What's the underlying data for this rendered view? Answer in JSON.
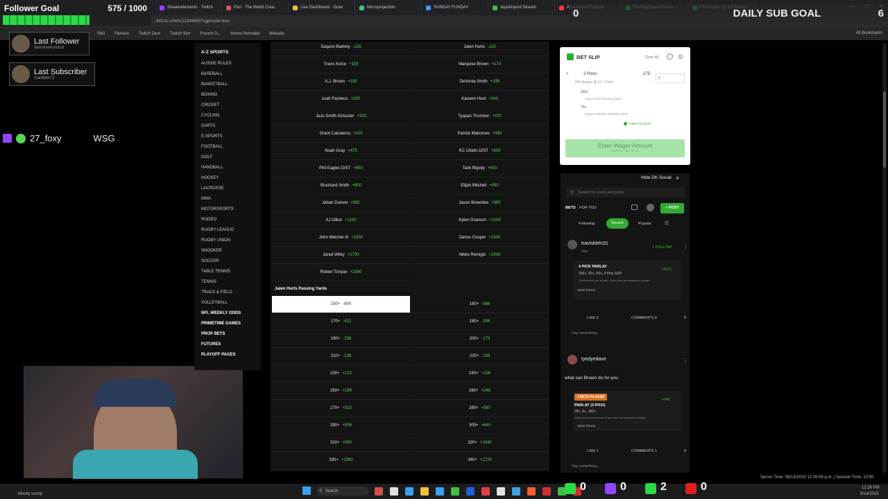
{
  "browser": {
    "tabs": [
      {
        "label": "Streamelements · Twitch",
        "color": "#9146ff"
      },
      {
        "label": "Purl · The Web3 Crea...",
        "color": "#e05050"
      },
      {
        "label": "Live Dashboard · Duse",
        "color": "#f0c040"
      },
      {
        "label": "Microprojection",
        "color": "#40c080"
      },
      {
        "label": "SUNDAY FUNDAY",
        "color": "#40a0f0"
      },
      {
        "label": "sbpulinyurd Stream",
        "color": "#40c040"
      },
      {
        "label": "Ameriquest Football",
        "color": "#e04040"
      },
      {
        "label": "FlutMagShow Stream",
        "color": "#40c040"
      },
      {
        "label": "PHI Eagles @ KC Chiefs",
        "color": "#40c040"
      }
    ],
    "url": "...840-kc-chiefs/12345690?sgpmode=true",
    "bookmarks": [
      "Skill",
      "Patreon",
      "Twitch Dest",
      "Twitch Stor",
      "French D...",
      "Home Remodel",
      "Website"
    ],
    "other_bookmarks": "All Bookmarks"
  },
  "overlay": {
    "follower_goal": {
      "label": "Follower Goal",
      "count": "575 / 1000",
      "progress": 0.575
    },
    "daily_sub_goal": {
      "left": "0",
      "label": "DAILY SUB GOAL",
      "right": "6"
    },
    "last_follower": {
      "title": "Last Follower",
      "name": "damonamontio3"
    },
    "last_subscriber": {
      "title": "Last Subscriber",
      "name": "Gambler72"
    },
    "chat": {
      "user": "27_foxy",
      "message": "WSG"
    }
  },
  "sidebar": {
    "heading": "A-Z SPORTS",
    "items": [
      "AUSSIE RULES",
      "BASEBALL",
      "BASKETBALL",
      "BOXING",
      "CRICKET",
      "CYCLING",
      "DARTS",
      "E-SPORTS",
      "FOOTBALL",
      "GOLF",
      "HANDBALL",
      "HOCKEY",
      "LACROSSE",
      "MMA",
      "MOTORSPORTS",
      "RODEO",
      "RUGBY LEAGUE",
      "RUGBY UNION",
      "SNOOKER",
      "SOCCER",
      "TABLE TENNIS",
      "TENNIS",
      "TRACK & FIELD",
      "VOLLEYBALL"
    ],
    "bold_items": [
      "NFL WEEKLY ODDS",
      "PRIMETIME GAMES",
      "PROP BETS",
      "FUTURES",
      "PLAYOFF PAGES"
    ]
  },
  "anytime_td": {
    "left": [
      {
        "name": "Saquon Barkley",
        "odds": "-135"
      },
      {
        "name": "Travis Kelce",
        "odds": "+155"
      },
      {
        "name": "A.J. Brown",
        "odds": "+190"
      },
      {
        "name": "Isiah Pacheco",
        "odds": "+200"
      },
      {
        "name": "JuJu Smith-Schuster",
        "odds": "+320"
      },
      {
        "name": "Grant Calcaterra",
        "odds": "+425"
      },
      {
        "name": "Noah Gray",
        "odds": "+475"
      },
      {
        "name": "Phil Eagles D/ST",
        "odds": "+650"
      },
      {
        "name": "Brashard Smith",
        "odds": "+900"
      },
      {
        "name": "Jahan Dotson",
        "odds": "+950"
      },
      {
        "name": "AJ Dillon",
        "odds": "+1100"
      },
      {
        "name": "John Metchie III",
        "odds": "+1500"
      },
      {
        "name": "Jared Wiley",
        "odds": "+1700"
      },
      {
        "name": "Robert Tonyan",
        "odds": "+2800"
      }
    ],
    "right": [
      {
        "name": "Jalen Hurts",
        "odds": "-115"
      },
      {
        "name": "Marquise Brown",
        "odds": "+170"
      },
      {
        "name": "DeVonta Smith",
        "odds": "+195"
      },
      {
        "name": "Kareem Hunt",
        "odds": "+240"
      },
      {
        "name": "Tyquan Thornton",
        "odds": "+370"
      },
      {
        "name": "Patrick Mahomes",
        "odds": "+450"
      },
      {
        "name": "KC Chiefs D/ST",
        "odds": "+600"
      },
      {
        "name": "Tank Bigsby",
        "odds": "+650"
      },
      {
        "name": "Elijah Mitchell",
        "odds": "+950"
      },
      {
        "name": "Jason Brownlee",
        "odds": "+950"
      },
      {
        "name": "Kylen Granson",
        "odds": "+1200"
      },
      {
        "name": "Darius Cooper",
        "odds": "+1500"
      },
      {
        "name": "Nikko Remigio",
        "odds": "+1900"
      }
    ]
  },
  "passing_yards": {
    "title": "Jalen Hurts Passing Yards",
    "left": [
      {
        "name": "150+",
        "odds": "-800"
      },
      {
        "name": "170+",
        "odds": "-412"
      },
      {
        "name": "190+",
        "odds": "-236"
      },
      {
        "name": "210+",
        "odds": "-138"
      },
      {
        "name": "230+",
        "odds": "+122"
      },
      {
        "name": "250+",
        "odds": "+199"
      },
      {
        "name": "270+",
        "odds": "+313"
      },
      {
        "name": "290+",
        "odds": "+506"
      },
      {
        "name": "310+",
        "odds": "+850"
      },
      {
        "name": "330+",
        "odds": "+1360"
      }
    ],
    "right": [
      {
        "name": "160+",
        "odds": "-568"
      },
      {
        "name": "180+",
        "odds": "-306"
      },
      {
        "name": "200+",
        "odds": "-173"
      },
      {
        "name": "220+",
        "odds": "-108"
      },
      {
        "name": "240+",
        "odds": "+156"
      },
      {
        "name": "260+",
        "odds": "+248"
      },
      {
        "name": "280+",
        "odds": "+397"
      },
      {
        "name": "300+",
        "odds": "+640"
      },
      {
        "name": "320+",
        "odds": "+1040"
      },
      {
        "name": "340+",
        "odds": "+1720"
      }
    ]
  },
  "betslip": {
    "title": "BET SLIP",
    "clear_all": "Clear All",
    "picks_label": "2 Picks",
    "picks_odds": "-175",
    "matchup": "Phil Eagles @ KC Chiefs",
    "wager_placeholder": "$",
    "pick1_line": "150+",
    "pick1_desc": "Jalen Hurts Passing Yards",
    "pick2_line": "70+",
    "pick2_desc": "Saquon Barkley Rushing Yards",
    "boost_label": "TURN TO SGPx",
    "enter_wager": "Enter Wager Amount",
    "minimum": "Minimum Bet: $0.10"
  },
  "social": {
    "hide_label": "Hide DK Social",
    "search_placeholder": "Search for users and posts",
    "tabs": [
      "BETS",
      "FOR YOU"
    ],
    "post_button": "+ POST",
    "filters": [
      "Following",
      "Recent",
      "Popular"
    ],
    "posts": [
      {
        "user": "travisklein31",
        "time": "now",
        "follow": "+ FOLLOW",
        "badge": "4 PICK PARLAY",
        "desc": "150+, 50+, 50+, 2 Pick SGP",
        "odds": "+1171",
        "note": "Odds shown are at time of post and are subject to change.",
        "view": "VIEW PICKS",
        "likes": "LIKE 0",
        "comments": "COMMENTS 0",
        "share": "0",
        "say": "Say something..."
      },
      {
        "user": "tyedyedave",
        "time": "",
        "text": "what can Brown do for you",
        "badge": "3 BETS PLACED",
        "title": "PARLAY (3 PICK)",
        "desc": "25+, 6+, 150+",
        "odds": "+745",
        "note": "Odds shown are at time of post and are subject to change.",
        "view": "VIEW PICKS",
        "likes": "LIKE 1",
        "comments": "COMMENTS 1",
        "share": "0",
        "say": "Say something..."
      }
    ]
  },
  "taskbar": {
    "search": "Search",
    "server_time": "Server Time: 09/14/2025 12:26:59 p.m. | Session Time: 10:50",
    "clock_time": "12:26 PM",
    "clock_date": "9/14/2025",
    "weather": "Mostly sunny",
    "counters": [
      "0",
      "0",
      "2",
      "0"
    ]
  }
}
